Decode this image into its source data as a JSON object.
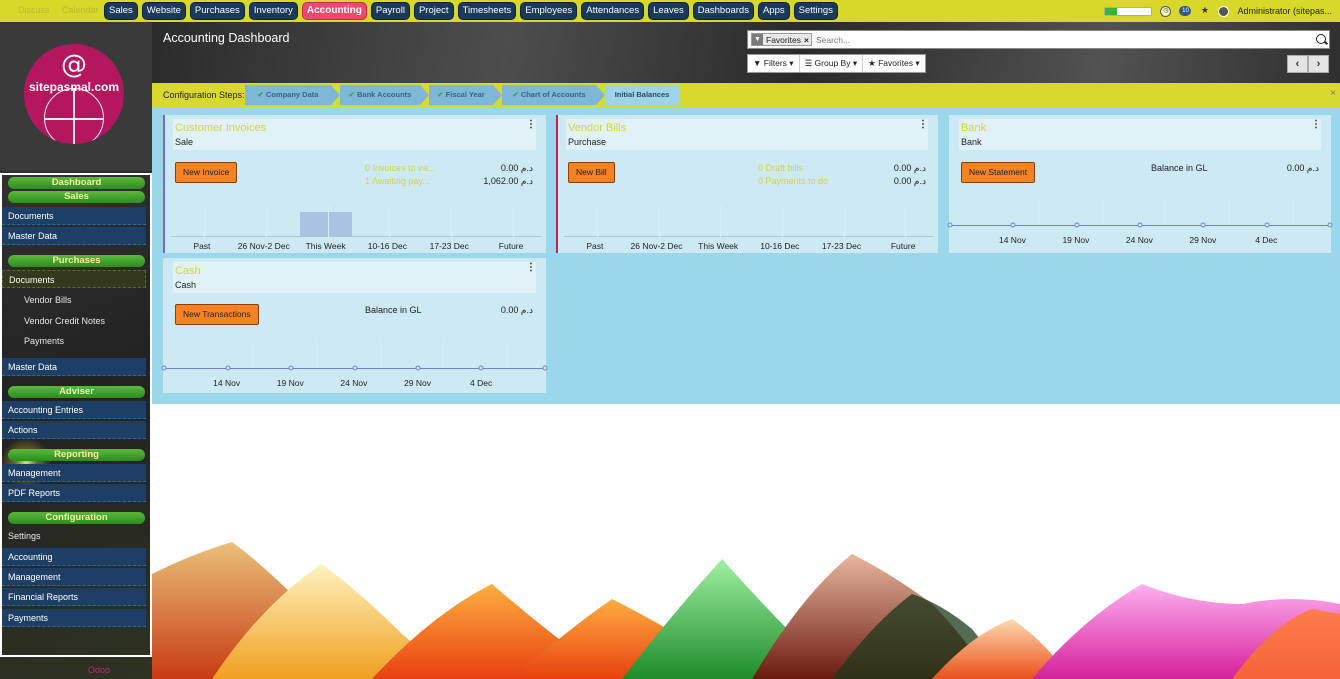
{
  "topbar": {
    "ghost_left": "Discuss",
    "ghost_right": "Calendar",
    "apps": [
      "Sales",
      "Website",
      "Purchases",
      "Inventory",
      "Accounting",
      "Payroll",
      "Project",
      "Timesheets",
      "Employees",
      "Attendances",
      "Leaves",
      "Dashboards",
      "Apps",
      "Settings"
    ],
    "active_app": "Accounting",
    "progress_fraction": 0.25,
    "notification_count": "10",
    "user": "Administrator (sitepas..."
  },
  "sidebar": {
    "logo_text": "sitepasmal.com",
    "sections": {
      "dashboard": "Dashboard",
      "sales": "Sales",
      "purchases": "Purchases",
      "adviser": "Adviser",
      "reporting": "Reporting",
      "configuration": "Configuration"
    },
    "items": {
      "sales_documents": "Documents",
      "sales_master": "Master Data",
      "purch_documents": "Documents",
      "vendor_bills": "Vendor Bills",
      "vendor_credit": "Vendor Credit Notes",
      "payments_sub": "Payments",
      "purch_master": "Master Data",
      "accounting_entries": "Accounting Entries",
      "actions": "Actions",
      "management": "Management",
      "pdf_reports": "PDF Reports",
      "settings": "Settings",
      "cfg_accounting": "Accounting",
      "cfg_management": "Management",
      "financial_reports": "Financial Reports",
      "cfg_payments": "Payments"
    },
    "footer": "Odoo"
  },
  "control_panel": {
    "title": "Accounting Dashboard",
    "facet": "Favorites",
    "search_placeholder": "Search...",
    "filters": "Filters",
    "group_by": "Group By",
    "favorites": "Favorites"
  },
  "config_steps": {
    "label": "Configuration Steps:",
    "steps": [
      "Company Data",
      "Bank Accounts",
      "Fiscal Year",
      "Chart of Accounts",
      "Initial Balances"
    ]
  },
  "cards": {
    "invoices": {
      "title": "Customer Invoices",
      "subtitle": "Sale",
      "button": "New Invoice",
      "line1": "0 Invoices to va...",
      "line1_amount": "0.00 د.م",
      "line2": "1 Awaiting pay...",
      "line2_amount": "1,062.00 د.م",
      "bar_labels": [
        "Past",
        "26 Nov-2 Dec",
        "This Week",
        "10-16 Dec",
        "17-23 Dec",
        "Future"
      ],
      "bar_values": [
        0,
        0,
        1062,
        0,
        0,
        0
      ]
    },
    "bills": {
      "title": "Vendor Bills",
      "subtitle": "Purchase",
      "button": "New Bill",
      "line1": "0 Draft bills",
      "line1_amount": "0.00 د.م",
      "line2": "0 Payments to do",
      "line2_amount": "0.00 د.م",
      "bar_labels": [
        "Past",
        "26 Nov-2 Dec",
        "This Week",
        "10-16 Dec",
        "17-23 Dec",
        "Future"
      ],
      "bar_values": [
        0,
        0,
        0,
        0,
        0,
        0
      ]
    },
    "bank": {
      "title": "Bank",
      "subtitle": "Bank",
      "button": "New Statement",
      "gl_label": "Balance in GL",
      "gl_amount": "0.00 د.م",
      "dates": [
        "14 Nov",
        "19 Nov",
        "24 Nov",
        "29 Nov",
        "4 Dec"
      ]
    },
    "cash": {
      "title": "Cash",
      "subtitle": "Cash",
      "button": "New Transactions",
      "gl_label": "Balance in GL",
      "gl_amount": "0.00 د.م",
      "dates": [
        "14 Nov",
        "19 Nov",
        "24 Nov",
        "29 Nov",
        "4 Dec"
      ]
    }
  },
  "colors": {
    "topbar": "#d7d829",
    "accent_active": "#f2476f",
    "app_button": "#1b3a5a",
    "content_bg": "#9bd7eb",
    "card_title": "#d6d43a",
    "orange_button": "#f68224"
  }
}
